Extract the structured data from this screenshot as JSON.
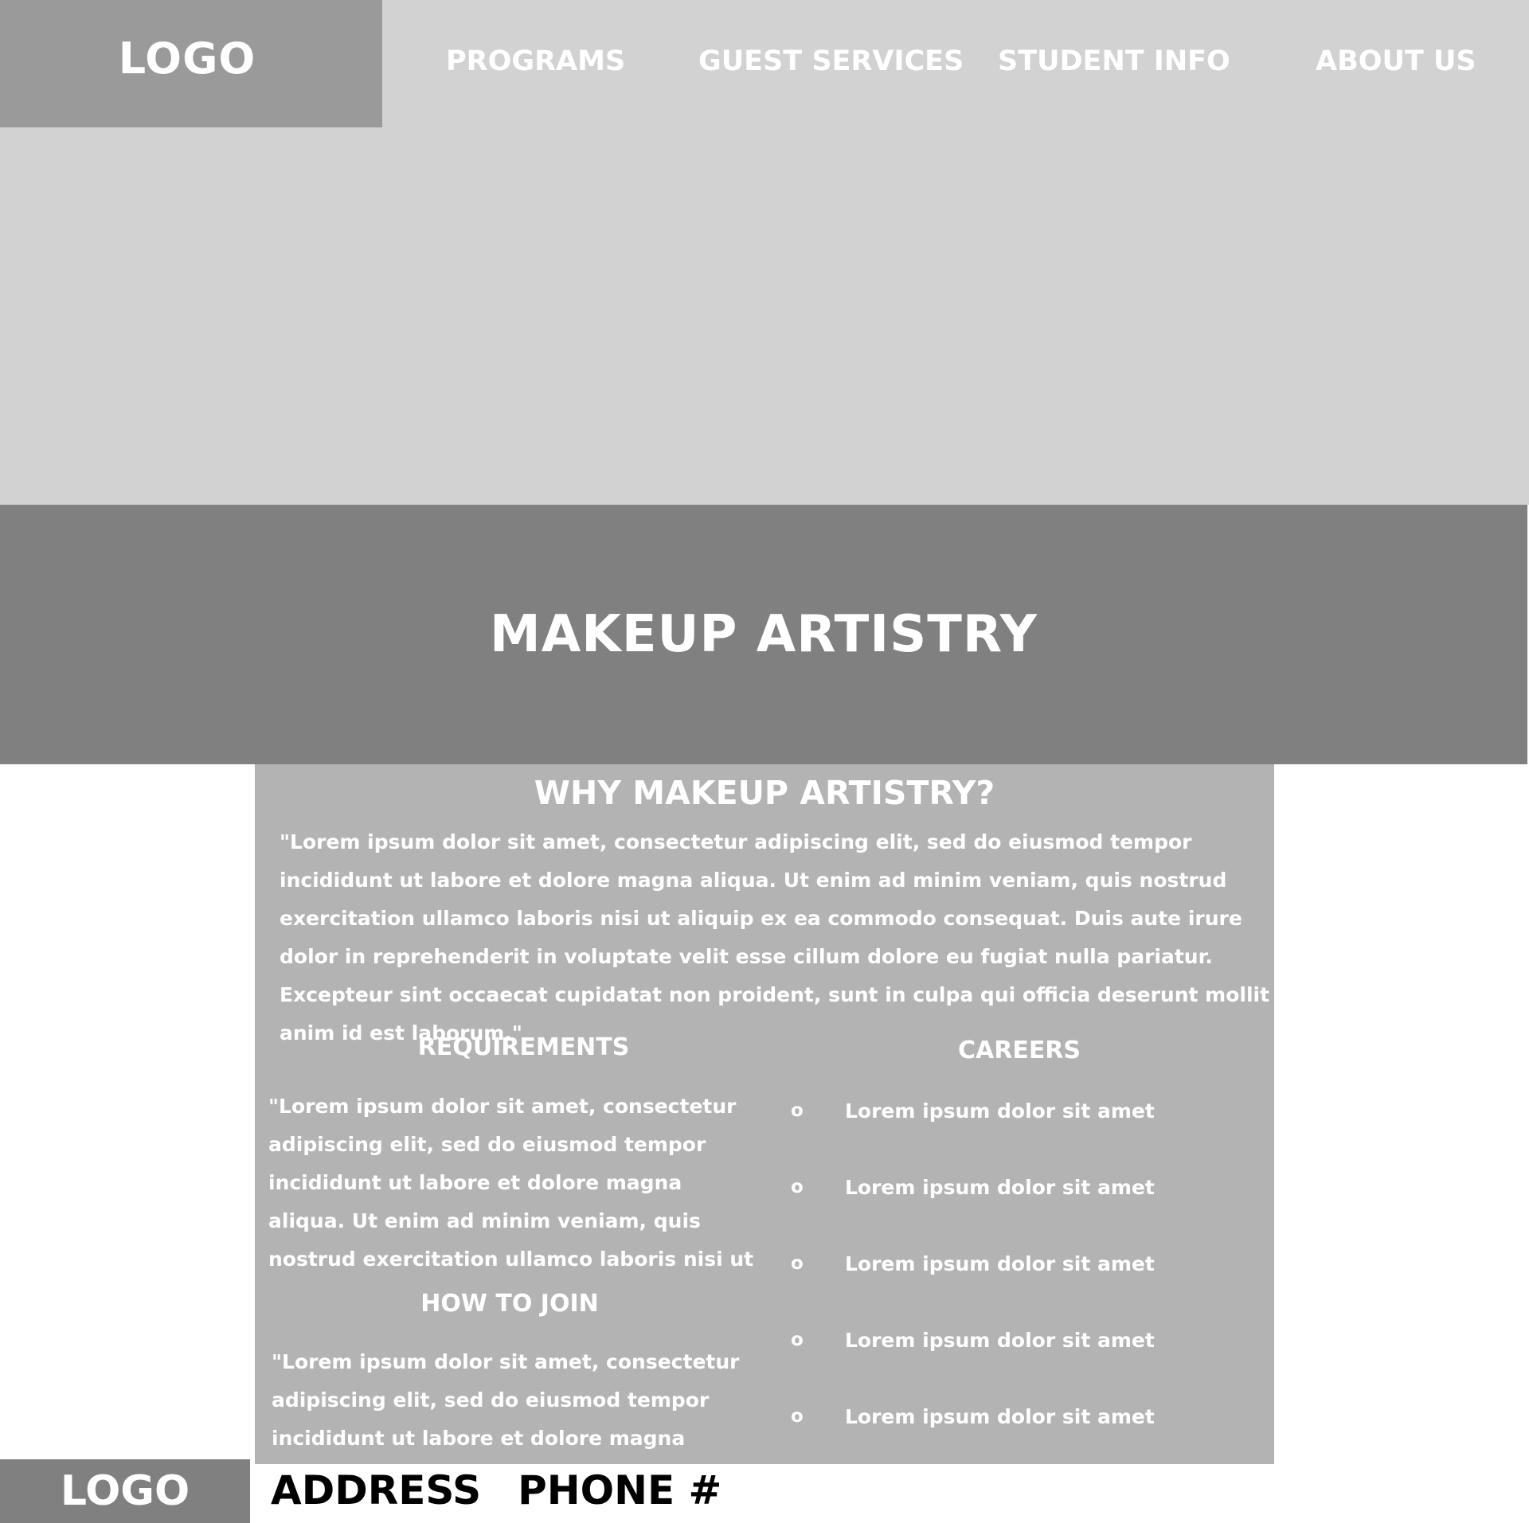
{
  "header": {
    "logo": "LOGO",
    "nav": [
      "PROGRAMS",
      "GUEST SERVICES",
      "STUDENT INFO",
      "ABOUT US"
    ]
  },
  "banner": {
    "title": "MAKEUP ARTISTRY"
  },
  "content": {
    "heading": "WHY MAKEUP ARTISTRY?",
    "intro": "\"Lorem ipsum dolor sit amet, consectetur adipiscing elit, sed do eiusmod tempor incididunt ut labore et dolore magna aliqua. Ut enim ad minim veniam, quis nostrud exercitation ullamco laboris nisi ut aliquip ex ea commodo consequat. Duis aute irure dolor in reprehenderit in voluptate velit esse cillum dolore eu fugiat nulla pariatur. Excepteur sint occaecat cupidatat non proident, sunt in culpa qui officia deserunt mollit anim id est laborum.\"",
    "requirements": {
      "heading": "REQUIREMENTS",
      "text": "\"Lorem ipsum dolor sit amet, consectetur adipiscing elit, sed do eiusmod tempor incididunt ut labore et dolore magna aliqua. Ut enim ad minim veniam, quis nostrud exercitation ullamco laboris nisi ut aliquip ex ea commodo consequat."
    },
    "how_to_join": {
      "heading": "HOW TO JOIN",
      "text": "\"Lorem ipsum dolor sit amet, consectetur adipiscing elit, sed do eiusmod tempor incididunt ut labore et dolore magna aliqua. Ut enim ad"
    },
    "careers": {
      "heading": "CAREERS",
      "items": [
        {
          "bullet": "o",
          "label": "Lorem ipsum dolor sit amet"
        },
        {
          "bullet": "o",
          "label": "Lorem ipsum dolor sit amet"
        },
        {
          "bullet": "o",
          "label": "Lorem ipsum dolor sit amet"
        },
        {
          "bullet": "o",
          "label": "Lorem ipsum dolor sit amet"
        },
        {
          "bullet": "o",
          "label": "Lorem ipsum dolor sit amet"
        }
      ]
    }
  },
  "footer": {
    "logo": "LOGO",
    "address": "ADDRESS",
    "phone": "PHONE #"
  },
  "colors": {
    "header_bg": "#d2d2d2",
    "logo_bg": "#9a9a9a",
    "banner_bg": "#808080",
    "content_bg": "#b3b3b3",
    "text": "#ffffff",
    "footer_text": "#000000"
  }
}
